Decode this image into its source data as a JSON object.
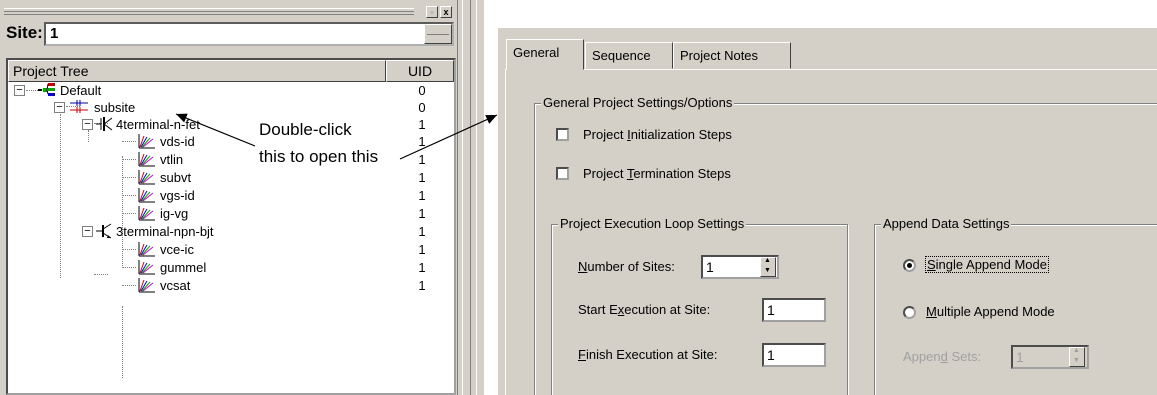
{
  "site": {
    "label": "Site:",
    "value": "1",
    "close_glyph": "x"
  },
  "tree": {
    "headers": {
      "project_tree": "Project Tree",
      "uid": "UID"
    },
    "rows": [
      {
        "label": "Default",
        "uid": "0",
        "icon": "project-tree-icon"
      },
      {
        "label": "subsite",
        "uid": "0",
        "icon": "subsite-icon"
      },
      {
        "label": "4terminal-n-fet",
        "uid": "1",
        "icon": "fet-icon"
      },
      {
        "label": "vds-id",
        "uid": "1",
        "icon": "plot-icon"
      },
      {
        "label": "vtlin",
        "uid": "1",
        "icon": "plot-icon"
      },
      {
        "label": "subvt",
        "uid": "1",
        "icon": "plot-icon"
      },
      {
        "label": "vgs-id",
        "uid": "1",
        "icon": "plot-icon"
      },
      {
        "label": "ig-vg",
        "uid": "1",
        "icon": "plot-icon"
      },
      {
        "label": "3terminal-npn-bjt",
        "uid": "1",
        "icon": "bjt-icon"
      },
      {
        "label": "vce-ic",
        "uid": "1",
        "icon": "plot-icon"
      },
      {
        "label": "gummel",
        "uid": "1",
        "icon": "plot-icon"
      },
      {
        "label": "vcsat",
        "uid": "1",
        "icon": "plot-icon"
      }
    ]
  },
  "annotation": {
    "line1": "Double-click",
    "line2": "this to open this"
  },
  "tabs": [
    {
      "label": "General",
      "active": true
    },
    {
      "label": "Sequence",
      "active": false
    },
    {
      "label": "Project Notes",
      "active": false
    }
  ],
  "general": {
    "group_title": "General Project Settings/Options",
    "init_steps": {
      "pre": "Project ",
      "u": "I",
      "post": "nitialization Steps",
      "checked": false
    },
    "term_steps": {
      "pre": "Project ",
      "u": "T",
      "post": "ermination Steps",
      "checked": false
    }
  },
  "loop": {
    "group_title": "Project Execution Loop Settings",
    "num_sites": {
      "u": "N",
      "post": "umber of Sites:",
      "value": "1"
    },
    "start_site": {
      "pre": "Start E",
      "u": "x",
      "post": "ecution at Site:",
      "value": "1"
    },
    "finish_site": {
      "u": "F",
      "post": "inish Execution at Site:",
      "value": "1"
    }
  },
  "append": {
    "group_title": "Append Data Settings",
    "single": {
      "u": "S",
      "post": "ingle Append Mode",
      "selected": true
    },
    "multiple": {
      "u": "M",
      "post": "ultiple Append Mode",
      "selected": false
    },
    "sets": {
      "pre": "Appen",
      "u": "d",
      "post": " Sets:",
      "value": "1"
    }
  }
}
